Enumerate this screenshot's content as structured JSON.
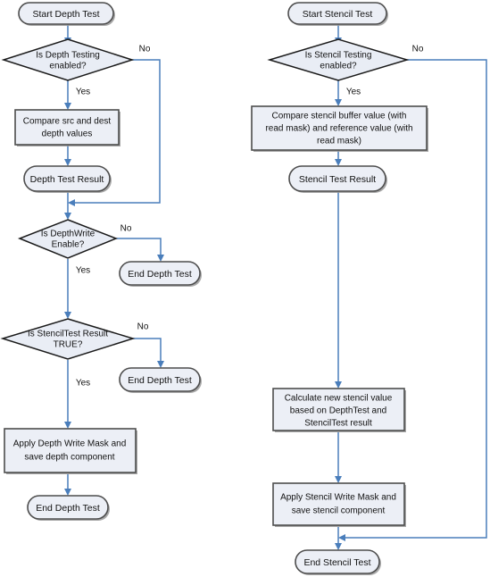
{
  "diagram": {
    "title": "Depth Test and Stencil Test Flowchart",
    "colors": {
      "node_fill": "#eceff6",
      "node_stroke": "#4d4d4d",
      "diamond_stroke": "#1a1a1a",
      "connector": "#4a7ebb",
      "shadow": "#9a9a9a",
      "background": "#ffffff",
      "text": "#111111"
    }
  },
  "depth_flow": {
    "name": "Depth Test",
    "nodes": {
      "start": {
        "type": "terminator",
        "label": "Start Depth Test"
      },
      "is_depth_testing": {
        "type": "decision",
        "label_line1": "Is Depth Testing",
        "label_line2": "enabled?"
      },
      "compare_depth": {
        "type": "process",
        "label_line1": "Compare src and dest",
        "label_line2": "depth values"
      },
      "depth_test_result": {
        "type": "terminator",
        "label": "Depth Test Result"
      },
      "is_depthwrite_enable": {
        "type": "decision",
        "label_line1": "Is DepthWrite",
        "label_line2": "Enable?"
      },
      "end_depth_test_a": {
        "type": "terminator",
        "label": "End Depth Test"
      },
      "is_stenciltest_true": {
        "type": "decision",
        "label_line1": "Is StencilTest Result",
        "label_line2": "TRUE?"
      },
      "end_depth_test_b": {
        "type": "terminator",
        "label": "End Depth Test"
      },
      "apply_depth_mask": {
        "type": "process",
        "label_line1": "Apply Depth Write Mask and",
        "label_line2": "save depth component"
      },
      "end_depth_test_c": {
        "type": "terminator",
        "label": "End Depth Test"
      }
    },
    "edge_labels": {
      "depth_testing_no": "No",
      "depth_testing_yes": "Yes",
      "depthwrite_no": "No",
      "depthwrite_yes": "Yes",
      "stenciltest_no": "No",
      "stenciltest_yes": "Yes"
    }
  },
  "stencil_flow": {
    "name": "Stencil Test",
    "nodes": {
      "start": {
        "type": "terminator",
        "label": "Start Stencil Test"
      },
      "is_stencil_testing": {
        "type": "decision",
        "label_line1": "Is Stencil Testing",
        "label_line2": "enabled?"
      },
      "compare_stencil": {
        "type": "process",
        "label_line1": "Compare stencil buffer value (with",
        "label_line2": "read mask) and reference value (with",
        "label_line3": "read mask)"
      },
      "stencil_test_result": {
        "type": "terminator",
        "label": "Stencil Test Result"
      },
      "calculate_stencil": {
        "type": "process",
        "label_line1": "Calculate new stencil value",
        "label_line2": "based on DepthTest and",
        "label_line3": "StencilTest result"
      },
      "apply_stencil_mask": {
        "type": "process",
        "label_line1": "Apply Stencil Write Mask and",
        "label_line2": "save stencil component"
      },
      "end_stencil_test": {
        "type": "terminator",
        "label": "End Stencil Test"
      }
    },
    "edge_labels": {
      "stencil_testing_no": "No",
      "stencil_testing_yes": "Yes"
    }
  }
}
